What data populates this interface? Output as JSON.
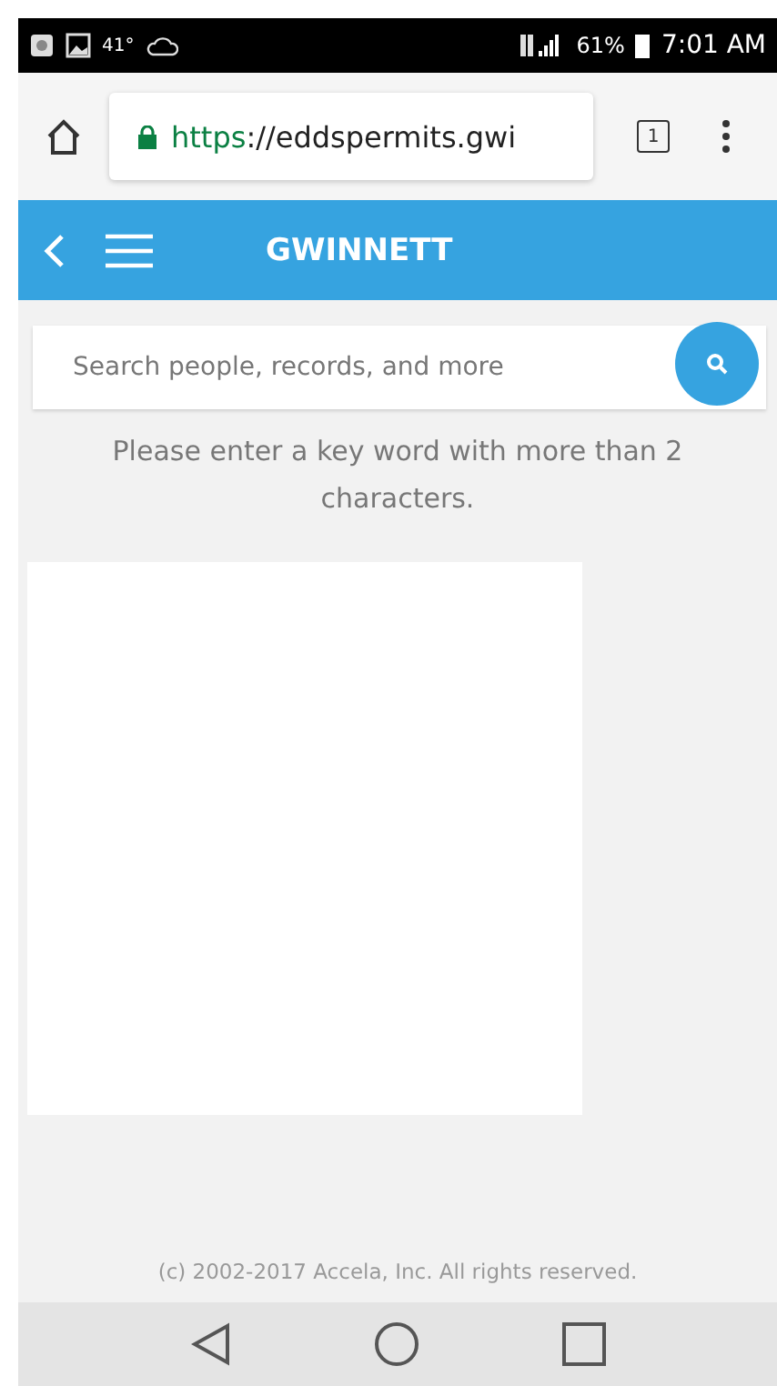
{
  "status_bar": {
    "temperature": "41°",
    "battery": "61%",
    "time": "7:01 AM"
  },
  "browser": {
    "url_scheme": "https",
    "url_rest": "://eddspermits.gwi",
    "tab_count": "1"
  },
  "header": {
    "title": "GWINNETT"
  },
  "search": {
    "placeholder": "Search people, records, and more"
  },
  "message": "Please enter a key word with more than 2 characters.",
  "footer": "(c) 2002-2017 Accela, Inc. All rights reserved."
}
